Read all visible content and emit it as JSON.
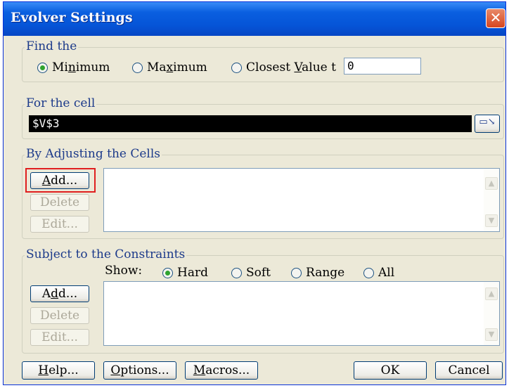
{
  "window": {
    "title": "Evolver Settings"
  },
  "find": {
    "legend": "Find the",
    "options": [
      {
        "pre": "Mi",
        "u": "n",
        "post": "imum",
        "selected": true
      },
      {
        "pre": "Ma",
        "u": "x",
        "post": "imum",
        "selected": false
      },
      {
        "pre": "Closest ",
        "u": "V",
        "post": "alue t",
        "selected": false
      }
    ],
    "value": "0"
  },
  "cell": {
    "legend": "For the cell",
    "value": "$V$3"
  },
  "adjust": {
    "legend": "By Adjusting the Cells",
    "add": {
      "u": "A",
      "post": "dd..."
    },
    "delete": "Delete",
    "edit": "Edit..."
  },
  "constraints": {
    "legend": "Subject to the Constraints",
    "show_label": "Show:",
    "options": [
      {
        "label": "Hard",
        "selected": true
      },
      {
        "label": "Soft",
        "selected": false
      },
      {
        "label": "Range",
        "selected": false
      },
      {
        "label": "All",
        "selected": false
      }
    ],
    "add": {
      "pre": "A",
      "u": "d",
      "post": "d..."
    },
    "delete": "Delete",
    "edit": "Edit..."
  },
  "footer": {
    "help": {
      "u": "H",
      "post": "elp..."
    },
    "options": {
      "u": "O",
      "post": "ptions..."
    },
    "macros": {
      "u": "M",
      "post": "acros..."
    },
    "ok": "OK",
    "cancel": "Cancel"
  },
  "icons": {
    "close": "close-icon",
    "ref": "cell-reference-icon",
    "scroll_up": "scroll-up-arrow-icon",
    "scroll_down": "scroll-down-arrow-icon"
  },
  "colors": {
    "titlebar": "#0554d7",
    "group_legend": "#1c3a8a",
    "highlight": "#e01f1f",
    "selected_radio": "#2fa32f"
  }
}
